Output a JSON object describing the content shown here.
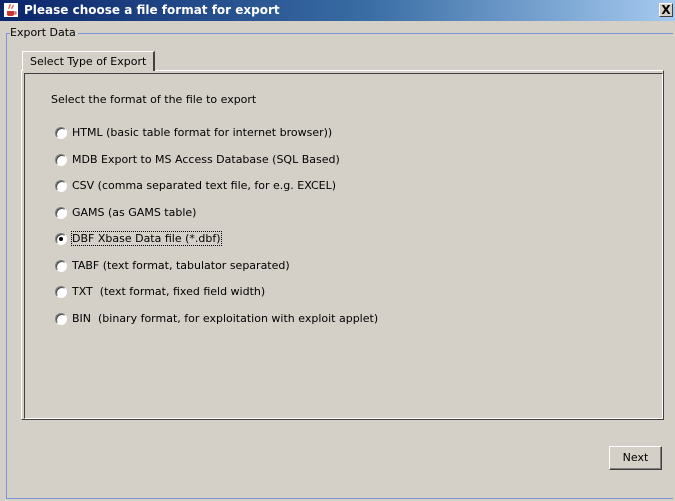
{
  "window": {
    "title": "Please choose a file format for export",
    "close_glyph": "X"
  },
  "group": {
    "label": "Export Data"
  },
  "tab": {
    "label": "Select Type of Export"
  },
  "panel": {
    "prompt": "Select the format of the file to export",
    "options": [
      {
        "label": "HTML (basic table format for internet browser))",
        "selected": false
      },
      {
        "label": "MDB Export to MS Access Database (SQL Based)",
        "selected": false
      },
      {
        "label": "CSV (comma separated text file, for e.g. EXCEL)",
        "selected": false
      },
      {
        "label": "GAMS (as GAMS table)",
        "selected": false
      },
      {
        "label": "DBF Xbase Data file (*.dbf)",
        "selected": true
      },
      {
        "label": "TABF (text format, tabulator separated)",
        "selected": false
      },
      {
        "label": "TXT  (text format, fixed field width)",
        "selected": false
      },
      {
        "label": "BIN  (binary format, for exploitation with exploit applet)",
        "selected": false
      }
    ]
  },
  "footer": {
    "next_label": "Next"
  }
}
